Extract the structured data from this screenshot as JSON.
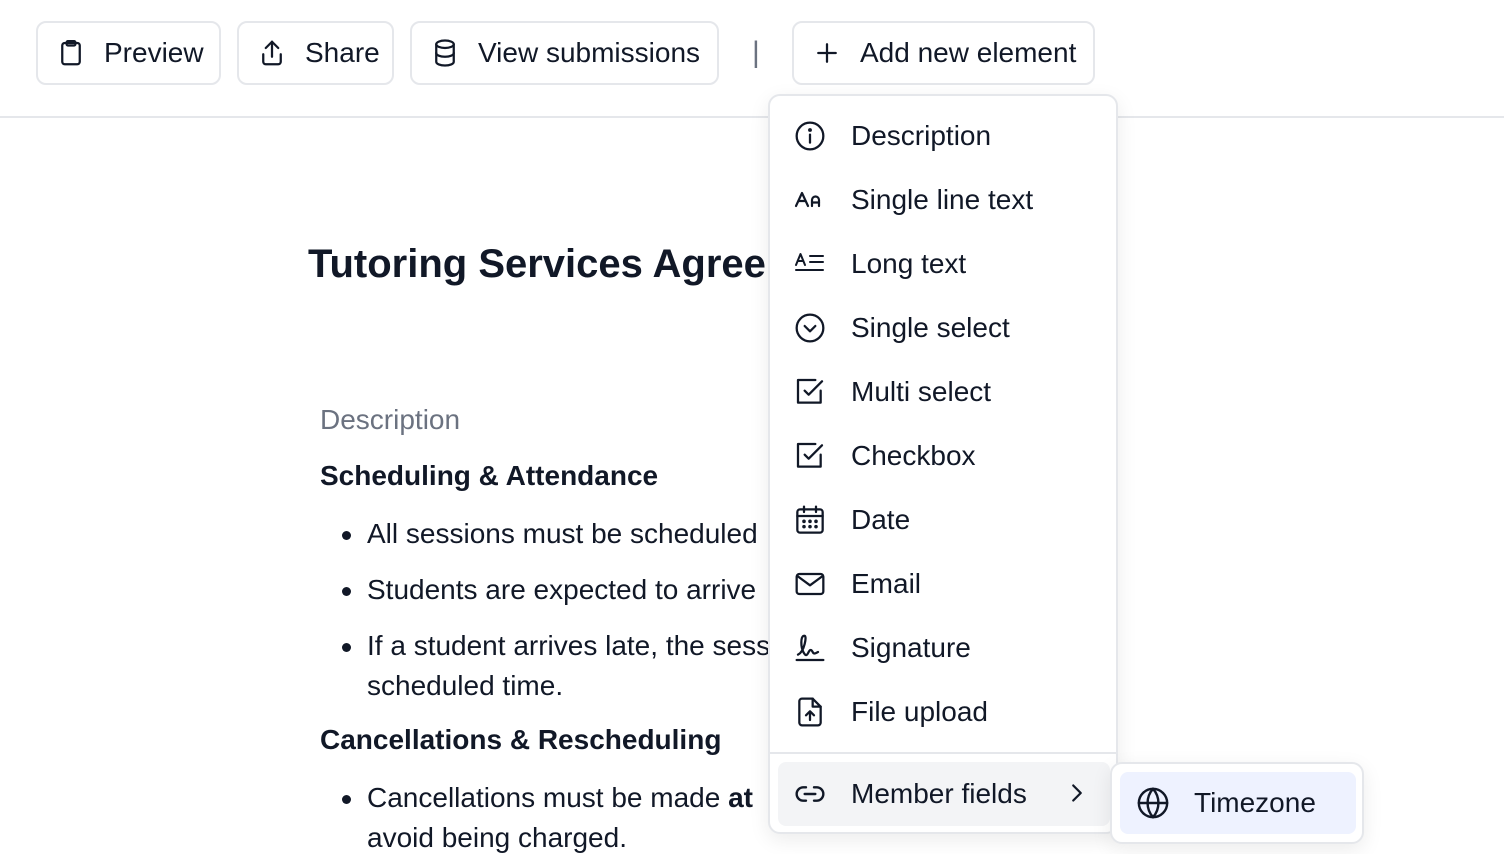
{
  "toolbar": {
    "preview_label": "Preview",
    "share_label": "Share",
    "view_submissions_label": "View submissions",
    "separator": "|",
    "add_element_label": "Add new element"
  },
  "document": {
    "title": "Tutoring Services Agreement",
    "section_label": "Description",
    "heading1": "Scheduling & Attendance",
    "bullets1": [
      "All sessions must be scheduled",
      "Students are expected to arrive",
      "If a student arrives late, the session",
      "scheduled time."
    ],
    "heading2": "Cancellations & Rescheduling",
    "bullets2": [
      "Cancellations must be made",
      "at",
      "avoid being charged."
    ]
  },
  "menu": {
    "items": [
      {
        "label": "Description",
        "icon": "info-icon"
      },
      {
        "label": "Single line text",
        "icon": "text-aa-icon"
      },
      {
        "label": "Long text",
        "icon": "long-text-icon"
      },
      {
        "label": "Single select",
        "icon": "chevron-circle-icon"
      },
      {
        "label": "Multi select",
        "icon": "checkbox-icon"
      },
      {
        "label": "Checkbox",
        "icon": "checkbox-icon"
      },
      {
        "label": "Date",
        "icon": "calendar-icon"
      },
      {
        "label": "Email",
        "icon": "mail-icon"
      },
      {
        "label": "Signature",
        "icon": "signature-icon"
      },
      {
        "label": "File upload",
        "icon": "file-upload-icon"
      }
    ],
    "member_fields_label": "Member fields"
  },
  "submenu": {
    "timezone_label": "Timezone"
  },
  "colors": {
    "border": "#e5e7eb",
    "muted_text": "#6b7280",
    "text": "#111827",
    "hover_bg": "#f3f4f6",
    "selected_bg": "#eef2ff"
  }
}
